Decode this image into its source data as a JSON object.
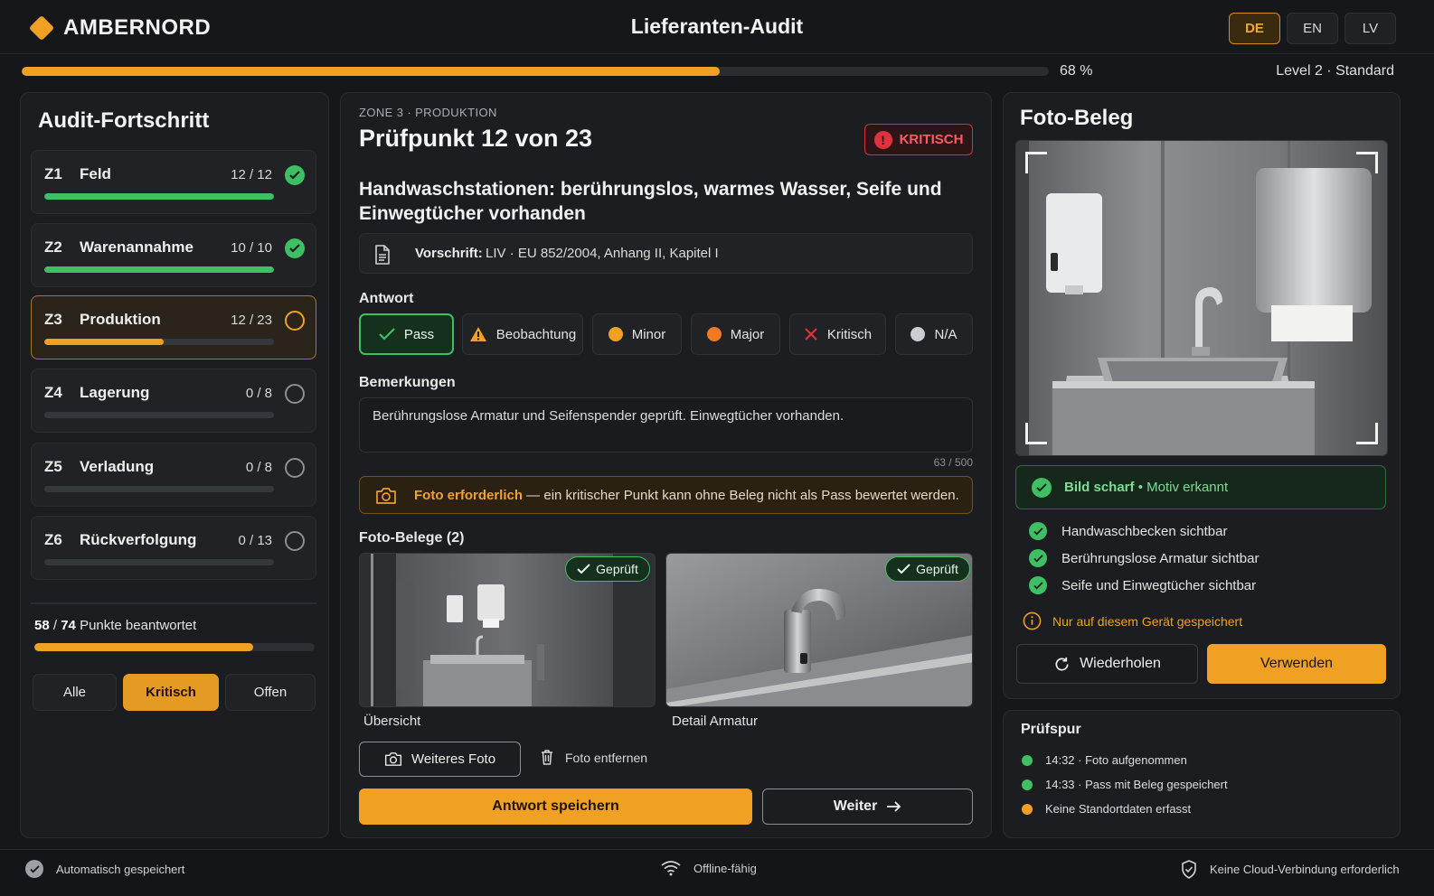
{
  "header": {
    "brand": "AMBERNORD",
    "title": "Lieferanten-Audit",
    "languages": [
      "DE",
      "EN",
      "LV"
    ],
    "active_language": "DE",
    "progress_percent": 68,
    "progress_label": "68 %",
    "level_label": "Level 2 · Standard"
  },
  "sidebar": {
    "title": "Audit-Fortschritt",
    "zones": [
      {
        "code": "Z1",
        "name": "Feld",
        "count": "12 / 12",
        "fraction": 1.0,
        "status": "done"
      },
      {
        "code": "Z2",
        "name": "Warenannahme",
        "count": "10 / 10",
        "fraction": 1.0,
        "status": "done"
      },
      {
        "code": "Z3",
        "name": "Produktion",
        "count": "12 / 23",
        "fraction": 0.52,
        "status": "active"
      },
      {
        "code": "Z4",
        "name": "Lagerung",
        "count": "0 / 8",
        "fraction": 0,
        "status": "open"
      },
      {
        "code": "Z5",
        "name": "Verladung",
        "count": "0 / 8",
        "fraction": 0,
        "status": "open"
      },
      {
        "code": "Z6",
        "name": "Rückverfolgung",
        "count": "0 / 13",
        "fraction": 0,
        "status": "open"
      }
    ],
    "answered_count": "58",
    "answered_total": "74",
    "answered_suffix": "Punkte beantwortet",
    "answered_fraction": 0.78,
    "filters": [
      "Alle",
      "Kritisch",
      "Offen"
    ],
    "active_filter": "Kritisch"
  },
  "main": {
    "breadcrumb": "ZONE 3 · PRODUKTION",
    "check_title": "Prüfpunkt 12 von 23",
    "severity_badge": "KRITISCH",
    "question": "Handwaschstationen: berührungslos, warmes Wasser, Seife und Einwegtücher vorhanden",
    "rule_label": "Vorschrift:",
    "rule_text": "LIV · EU 852/2004, Anhang II, Kapitel I",
    "answer_label": "Antwort",
    "answers": [
      {
        "label": "Pass",
        "icon": "check-icon",
        "color": "#3fbf63"
      },
      {
        "label": "Beobachtung",
        "icon": "warning-icon",
        "color": "#f0a124"
      },
      {
        "label": "Minor",
        "icon": "dot-icon",
        "color": "#f0a124"
      },
      {
        "label": "Major",
        "icon": "dot-icon",
        "color": "#ee7a22"
      },
      {
        "label": "Kritisch",
        "icon": "x-icon",
        "color": "#e0313d"
      },
      {
        "label": "N/A",
        "icon": "dot-icon",
        "color": "#c9ccd1"
      }
    ],
    "selected_answer": "Pass",
    "remarks_label": "Bemerkungen",
    "remarks_text": "Berührungslose Armatur und Seifenspender geprüft. Einwegtücher vorhanden.",
    "remarks_count": "63 / 500",
    "photo_warning_strong": "Foto erforderlich",
    "photo_warning_text": " — ein kritischer Punkt kann ohne Beleg nicht als Pass bewertet werden.",
    "photos_label": "Foto-Belege (2)",
    "photos": [
      {
        "caption": "Übersicht",
        "badge": "Geprüft"
      },
      {
        "caption": "Detail Armatur",
        "badge": "Geprüft"
      }
    ],
    "add_photo_label": "Weiteres Foto",
    "remove_photo_label": "Foto entfernen",
    "save_label": "Antwort speichern",
    "next_label": "Weiter"
  },
  "photo_panel": {
    "title": "Foto-Beleg",
    "status_strong": "Bild scharf",
    "status_rest": " • Motiv erkannt",
    "checks": [
      "Handwaschbecken sichtbar",
      "Berührungslose Armatur sichtbar",
      "Seife und Einwegtücher sichtbar"
    ],
    "local_note": "Nur auf diesem Gerät gespeichert",
    "retake_label": "Wiederholen",
    "use_label": "Verwenden"
  },
  "trail": {
    "title": "Prüfspur",
    "items": [
      {
        "text": "14:32 · Foto aufgenommen",
        "color": "#3fbf63"
      },
      {
        "text": "14:33 · Pass mit Beleg gespeichert",
        "color": "#3fbf63"
      },
      {
        "text": "Keine Standortdaten erfasst",
        "color": "#f0a124"
      }
    ]
  },
  "footer": {
    "autosave": "Automatisch gespeichert",
    "offline": "Offline-fähig",
    "cloud": "Keine Cloud-Verbindung erforderlich"
  }
}
